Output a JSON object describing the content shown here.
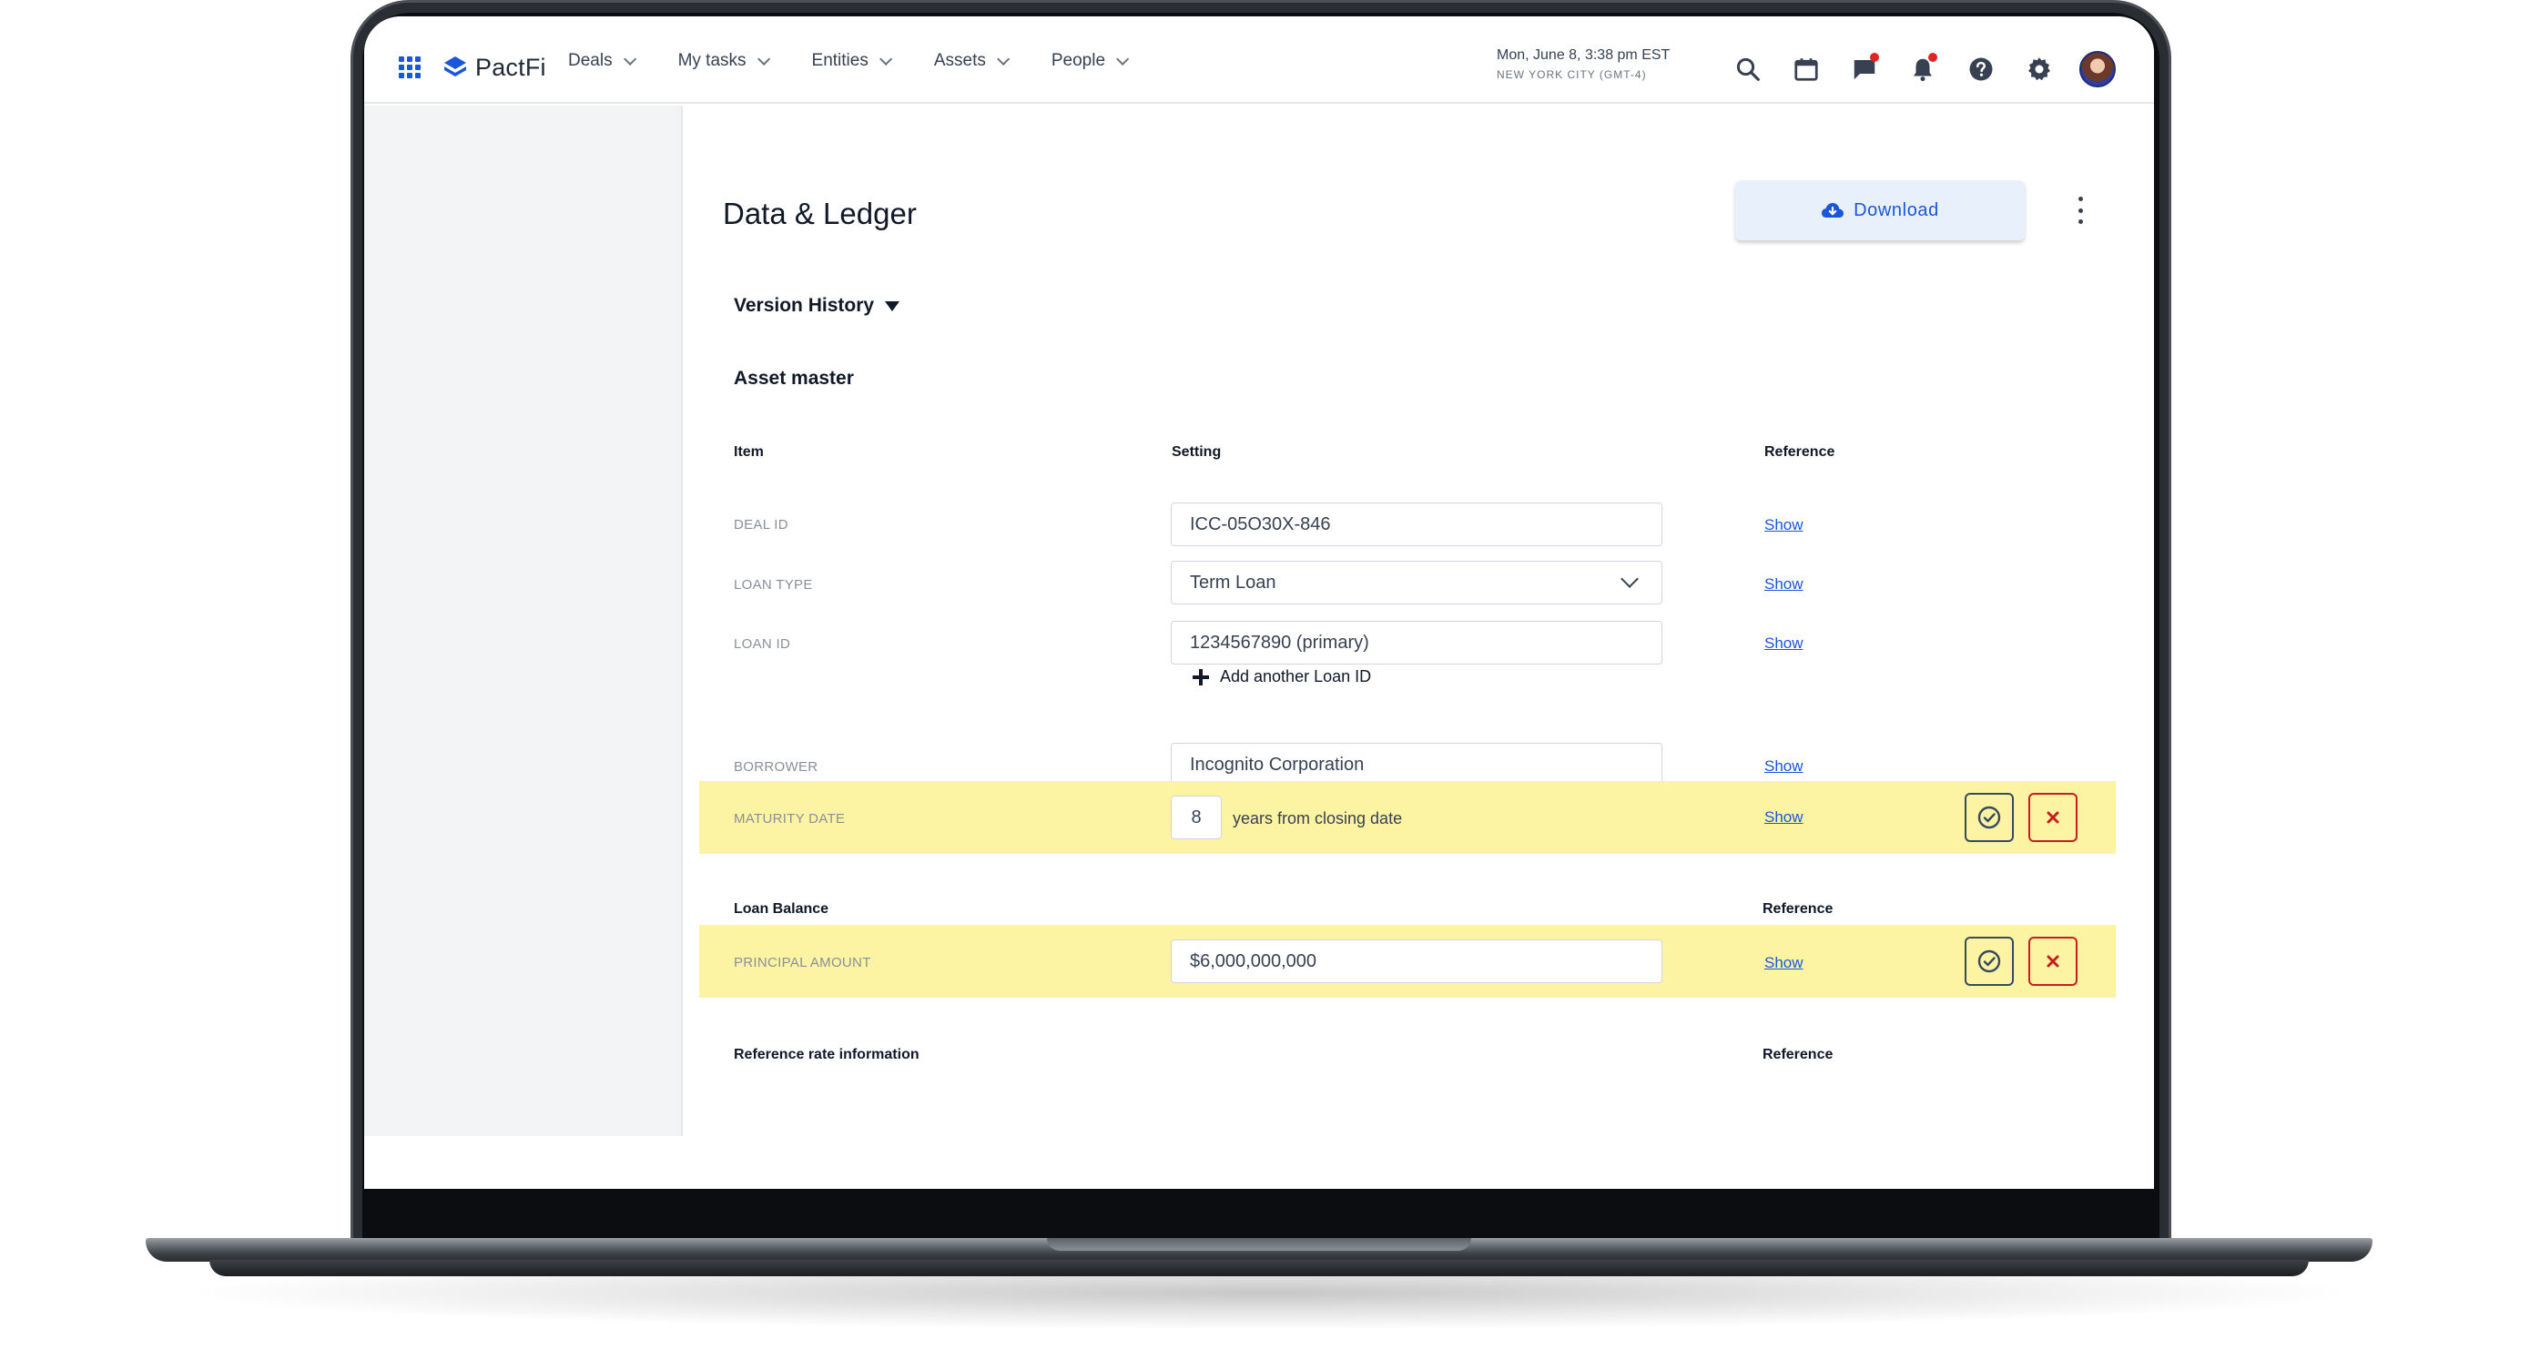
{
  "app": {
    "brand": "PactFi"
  },
  "nav": {
    "items": [
      {
        "label": "Deals"
      },
      {
        "label": "My tasks"
      },
      {
        "label": "Entities"
      },
      {
        "label": "Assets"
      },
      {
        "label": "People"
      }
    ]
  },
  "datetime": {
    "main": "Mon, June 8, 3:38 pm EST",
    "sub": "NEW YORK CITY (GMT-4)"
  },
  "page": {
    "title": "Data & Ledger",
    "download_label": "Download",
    "version_history": "Version History",
    "section_title": "Asset master"
  },
  "columns": {
    "item": "Item",
    "setting": "Setting",
    "reference": "Reference"
  },
  "rows": {
    "deal_id": {
      "label": "DEAL ID",
      "value": "ICC-05O30X-846",
      "ref": "Show"
    },
    "loan_type": {
      "label": "LOAN TYPE",
      "value": "Term Loan",
      "ref": "Show"
    },
    "loan_id": {
      "label": "LOAN ID",
      "value": "1234567890 (primary)",
      "ref": "Show"
    },
    "add_loan": "Add another Loan ID",
    "borrower": {
      "label": "BORROWER",
      "value": "Incognito Corporation",
      "ref": "Show"
    },
    "maturity": {
      "label": "MATURITY DATE",
      "value": "8",
      "suffix": "years from closing date",
      "ref": "Show"
    }
  },
  "loan_balance": {
    "title": "Loan Balance",
    "reference": "Reference",
    "principal": {
      "label": "PRINCIPAL AMOUNT",
      "value": "$6,000,000,000",
      "ref": "Show"
    }
  },
  "reference_rate": {
    "title": "Reference rate information",
    "reference": "Reference"
  },
  "colors": {
    "accent": "#1a56db",
    "highlight": "#fdf4a3",
    "reject": "#c81e1e"
  }
}
